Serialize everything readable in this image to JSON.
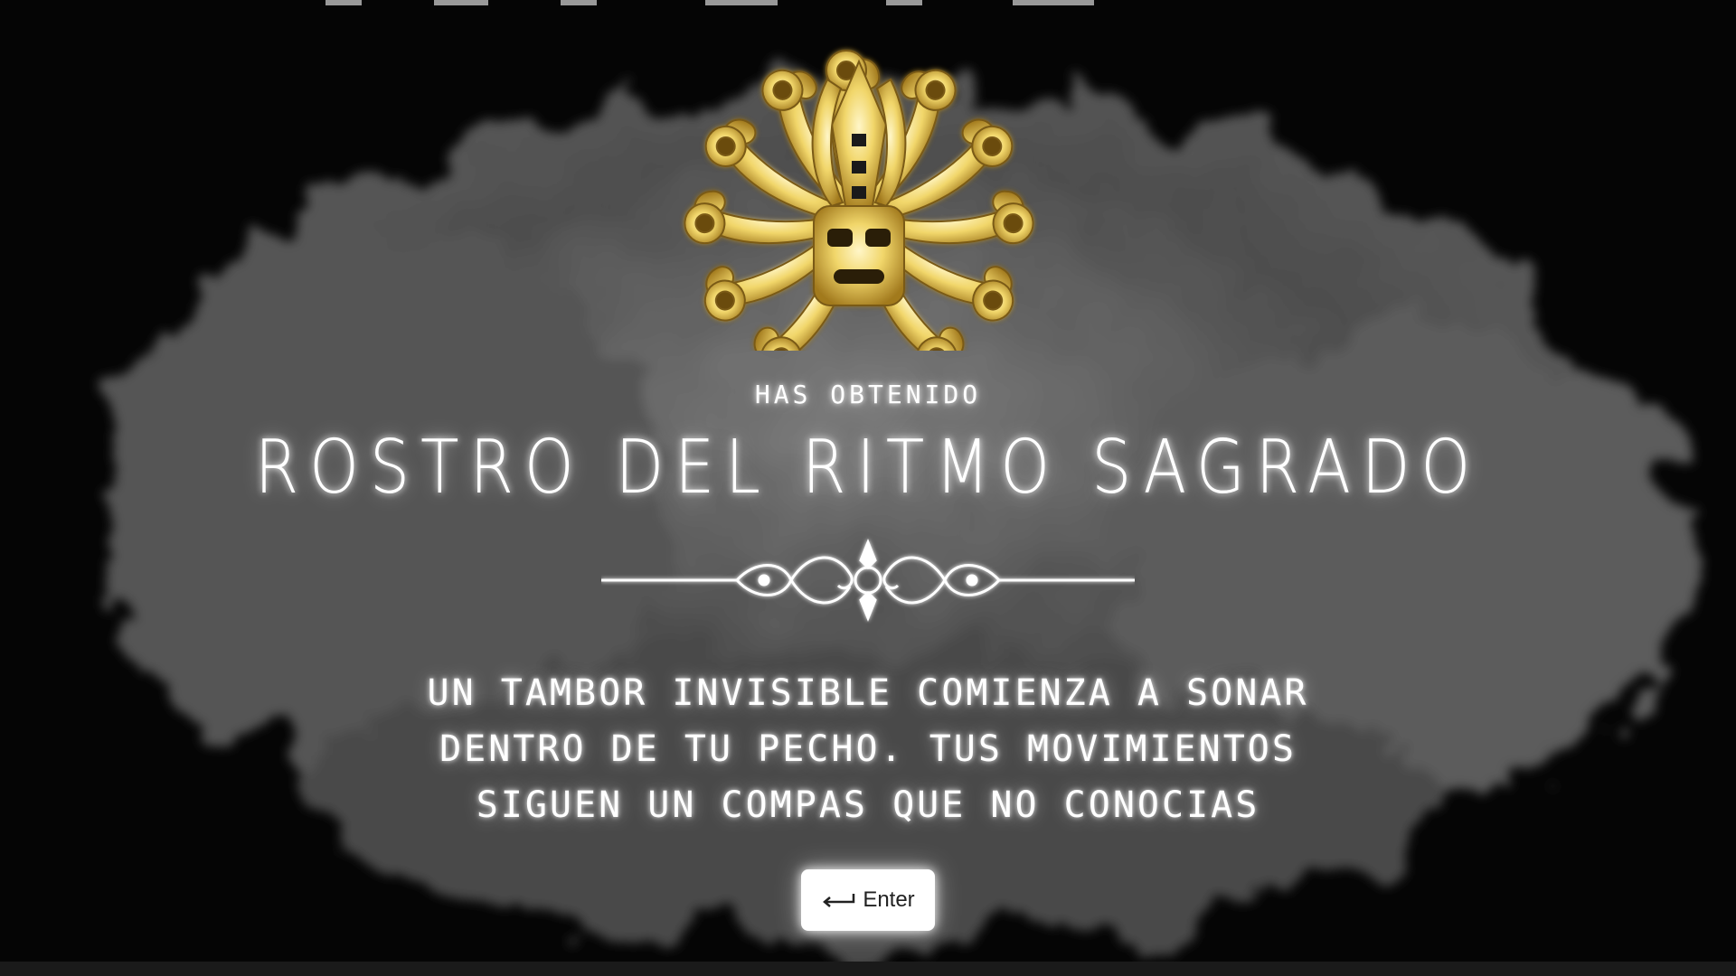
{
  "reward": {
    "subtitle": "HAS OBTENIDO",
    "title": "ROSTRO DEL RITMO SAGRADO",
    "description": "UN TAMBOR INVISIBLE COMIENZA A SONAR DENTRO DE TU PECHO. TUS MOVIMIENTOS SIGUEN UN COMPAS QUE NO CONOCIAS",
    "item_icon": "golden-mask-icon"
  },
  "enter_button": {
    "label": "Enter",
    "icon": "enter-key-icon"
  },
  "colors": {
    "background": "#050505",
    "text": "#ffffff",
    "gold": "#e8c24a",
    "button": "#ffffff"
  }
}
